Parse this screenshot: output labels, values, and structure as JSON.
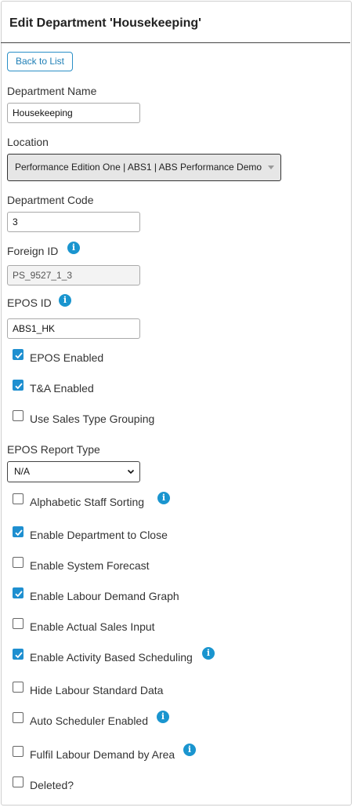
{
  "header": {
    "title": "Edit Department 'Housekeeping'"
  },
  "back_button": "Back to List",
  "fields": {
    "department_name": {
      "label": "Department Name",
      "value": "Housekeeping"
    },
    "location": {
      "label": "Location",
      "value": "Performance Edition One | ABS1 | ABS Performance Demo"
    },
    "department_code": {
      "label": "Department Code",
      "value": "3"
    },
    "foreign_id": {
      "label": "Foreign ID",
      "value": "PS_9527_1_3"
    },
    "epos_id": {
      "label": "EPOS ID",
      "value": "ABS1_HK"
    },
    "epos_report_type": {
      "label": "EPOS Report Type",
      "value": "N/A"
    }
  },
  "checkboxes": {
    "epos_enabled": {
      "label": "EPOS Enabled",
      "checked": true
    },
    "ta_enabled": {
      "label": "T&A Enabled",
      "checked": true
    },
    "sales_type_grouping": {
      "label": "Use Sales Type Grouping",
      "checked": false
    },
    "alphabetic_sorting": {
      "label": "Alphabetic Staff Sorting",
      "checked": false
    },
    "department_close": {
      "label": "Enable Department to Close",
      "checked": true
    },
    "system_forecast": {
      "label": "Enable System Forecast",
      "checked": false
    },
    "labour_demand_graph": {
      "label": "Enable Labour Demand Graph",
      "checked": true
    },
    "actual_sales_input": {
      "label": "Enable Actual Sales Input",
      "checked": false
    },
    "activity_scheduling": {
      "label": "Enable Activity Based Scheduling",
      "checked": true
    },
    "hide_labour_standard": {
      "label": "Hide Labour Standard Data",
      "checked": false
    },
    "auto_scheduler": {
      "label": "Auto Scheduler Enabled",
      "checked": false
    },
    "fulfil_by_area": {
      "label": "Fulfil Labour Demand by Area",
      "checked": false
    },
    "deleted": {
      "label": "Deleted?",
      "checked": false
    }
  },
  "info_icon_glyph": "i",
  "colors": {
    "accent": "#1e8fd0",
    "button_border": "#2a8fc7"
  }
}
